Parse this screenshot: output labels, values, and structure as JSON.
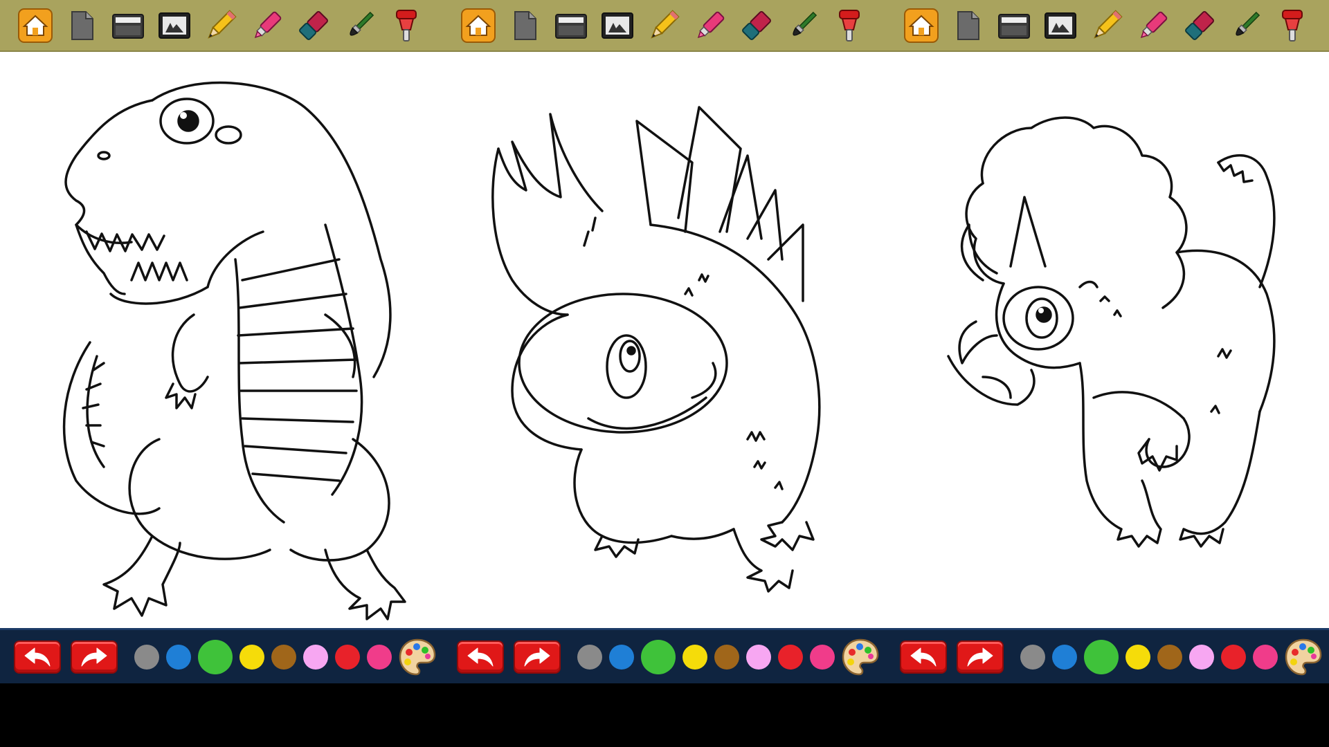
{
  "toolbar": {
    "sections": 3,
    "tools": [
      "home-icon",
      "new-page-icon",
      "save-icon",
      "gallery-icon",
      "pencil-icon",
      "marker-icon",
      "eraser-icon",
      "brush-icon",
      "paint-bucket-icon"
    ]
  },
  "canvas": {
    "drawings": [
      "t-rex-outline",
      "stegosaurus-outline",
      "triceratops-outline"
    ]
  },
  "palette": {
    "colors": [
      "#8a8a8a",
      "#1f7fd6",
      "#3fc23a",
      "#f5dc0a",
      "#a0661a",
      "#f7a7f2",
      "#e8222a",
      "#f03c8a"
    ],
    "selected_index": 2,
    "accent": "#e01818",
    "toolbar_bg": "#a9a35e",
    "bottom_bg": "#0f2440"
  }
}
